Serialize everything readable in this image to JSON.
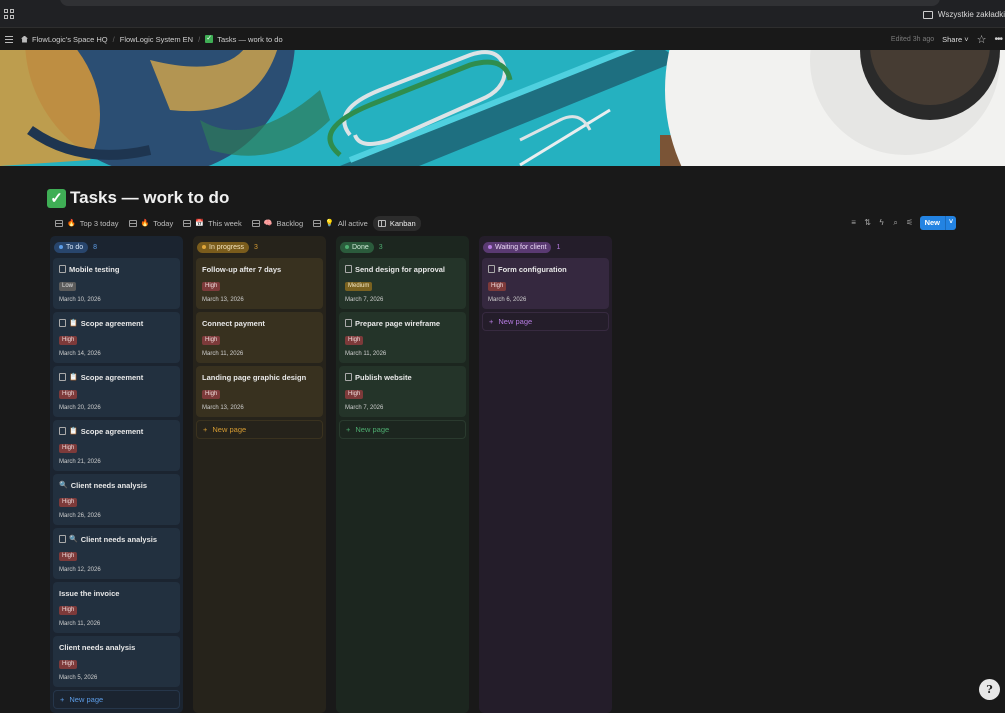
{
  "browser": {
    "bookmarks_label": "Wszystkie zakładki"
  },
  "topbar": {
    "breadcrumbs": [
      "FlowLogic's Space HQ",
      "FlowLogic System EN",
      "Tasks — work to do"
    ],
    "edited": "Edited 3h ago",
    "share_label": "Share"
  },
  "page": {
    "title": "Tasks — work to do",
    "title_icon": "check-mark-emoji"
  },
  "views": [
    {
      "emoji": "🔥",
      "label": "Top 3 today",
      "icon": "table-icon"
    },
    {
      "emoji": "🔥",
      "label": "Today",
      "icon": "table-icon"
    },
    {
      "emoji": "📅",
      "label": "This week",
      "icon": "table-icon"
    },
    {
      "emoji": "🧠",
      "label": "Backlog",
      "icon": "table-icon"
    },
    {
      "emoji": "💡",
      "label": "All active",
      "icon": "table-icon"
    },
    {
      "emoji": "",
      "label": "Kanban",
      "icon": "kanban-icon",
      "active": true
    }
  ],
  "toolbar": {
    "new_label": "New"
  },
  "board": {
    "new_page_label": "New page",
    "columns": [
      {
        "status": "To do",
        "count": "8",
        "cards": [
          {
            "title": "Mobile testing",
            "emoji": "",
            "priority": "Low",
            "date": "March 10, 2026",
            "doc": true
          },
          {
            "title": "Scope agreement",
            "emoji": "📋",
            "priority": "High",
            "date": "March 14, 2026",
            "doc": true
          },
          {
            "title": "Scope agreement",
            "emoji": "📋",
            "priority": "High",
            "date": "March 20, 2026",
            "doc": true
          },
          {
            "title": "Scope agreement",
            "emoji": "📋",
            "priority": "High",
            "date": "March 21, 2026",
            "doc": true
          },
          {
            "title": "Client needs analysis",
            "emoji": "🔍",
            "priority": "High",
            "date": "March 26, 2026",
            "doc": false
          },
          {
            "title": "Client needs analysis",
            "emoji": "🔍",
            "priority": "High",
            "date": "March 12, 2026",
            "doc": true
          },
          {
            "title": "Issue the invoice",
            "emoji": "",
            "priority": "High",
            "date": "March 11, 2026",
            "doc": false
          },
          {
            "title": "Client needs analysis",
            "emoji": "",
            "priority": "High",
            "date": "March 5, 2026",
            "doc": false
          }
        ]
      },
      {
        "status": "In progress",
        "count": "3",
        "cards": [
          {
            "title": "Follow-up after 7 days",
            "emoji": "",
            "priority": "High",
            "date": "March 13, 2026",
            "doc": false
          },
          {
            "title": "Connect payment",
            "emoji": "",
            "priority": "High",
            "date": "March 11, 2026",
            "doc": false
          },
          {
            "title": "Landing page graphic design",
            "emoji": "",
            "priority": "High",
            "date": "March 13, 2026",
            "doc": false
          }
        ]
      },
      {
        "status": "Done",
        "count": "3",
        "cards": [
          {
            "title": "Send design for approval",
            "emoji": "",
            "priority": "Medium",
            "date": "March 7, 2026",
            "doc": true
          },
          {
            "title": "Prepare page wireframe",
            "emoji": "",
            "priority": "High",
            "date": "March 11, 2026",
            "doc": true
          },
          {
            "title": "Publish website",
            "emoji": "",
            "priority": "High",
            "date": "March 7, 2026",
            "doc": true
          }
        ]
      },
      {
        "status": "Waiting for client",
        "count": "1",
        "cards": [
          {
            "title": "Form configuration",
            "emoji": "",
            "priority": "High",
            "date": "March 6, 2026",
            "doc": true
          }
        ]
      }
    ]
  },
  "colors": {
    "todo": "#5c9ce6",
    "in_progress": "#e0a63b",
    "done": "#4dab6f",
    "waiting": "#b57be0",
    "accent": "#2383e2"
  }
}
